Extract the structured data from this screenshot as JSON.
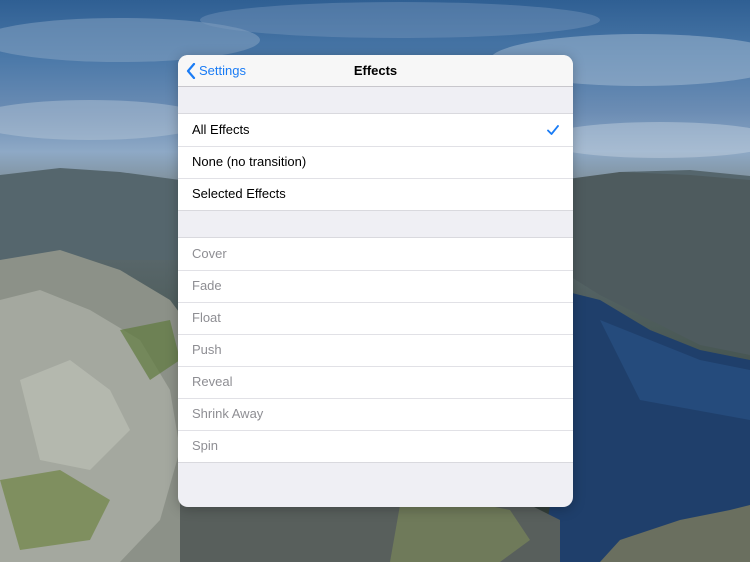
{
  "navbar": {
    "back_label": "Settings",
    "title": "Effects"
  },
  "options": [
    {
      "label": "All Effects",
      "selected": true
    },
    {
      "label": "None (no transition)",
      "selected": false
    },
    {
      "label": "Selected Effects",
      "selected": false
    }
  ],
  "effects": [
    {
      "label": "Cover",
      "enabled": false
    },
    {
      "label": "Fade",
      "enabled": false
    },
    {
      "label": "Float",
      "enabled": false
    },
    {
      "label": "Push",
      "enabled": false
    },
    {
      "label": "Reveal",
      "enabled": false
    },
    {
      "label": "Shrink Away",
      "enabled": false
    },
    {
      "label": "Spin",
      "enabled": false
    }
  ],
  "icons": {
    "back": "chevron-left-icon",
    "selected": "checkmark-icon"
  },
  "colors": {
    "accent": "#1a7cf5",
    "disabled_text": "#8e8e93",
    "group_background": "#efeff4"
  }
}
